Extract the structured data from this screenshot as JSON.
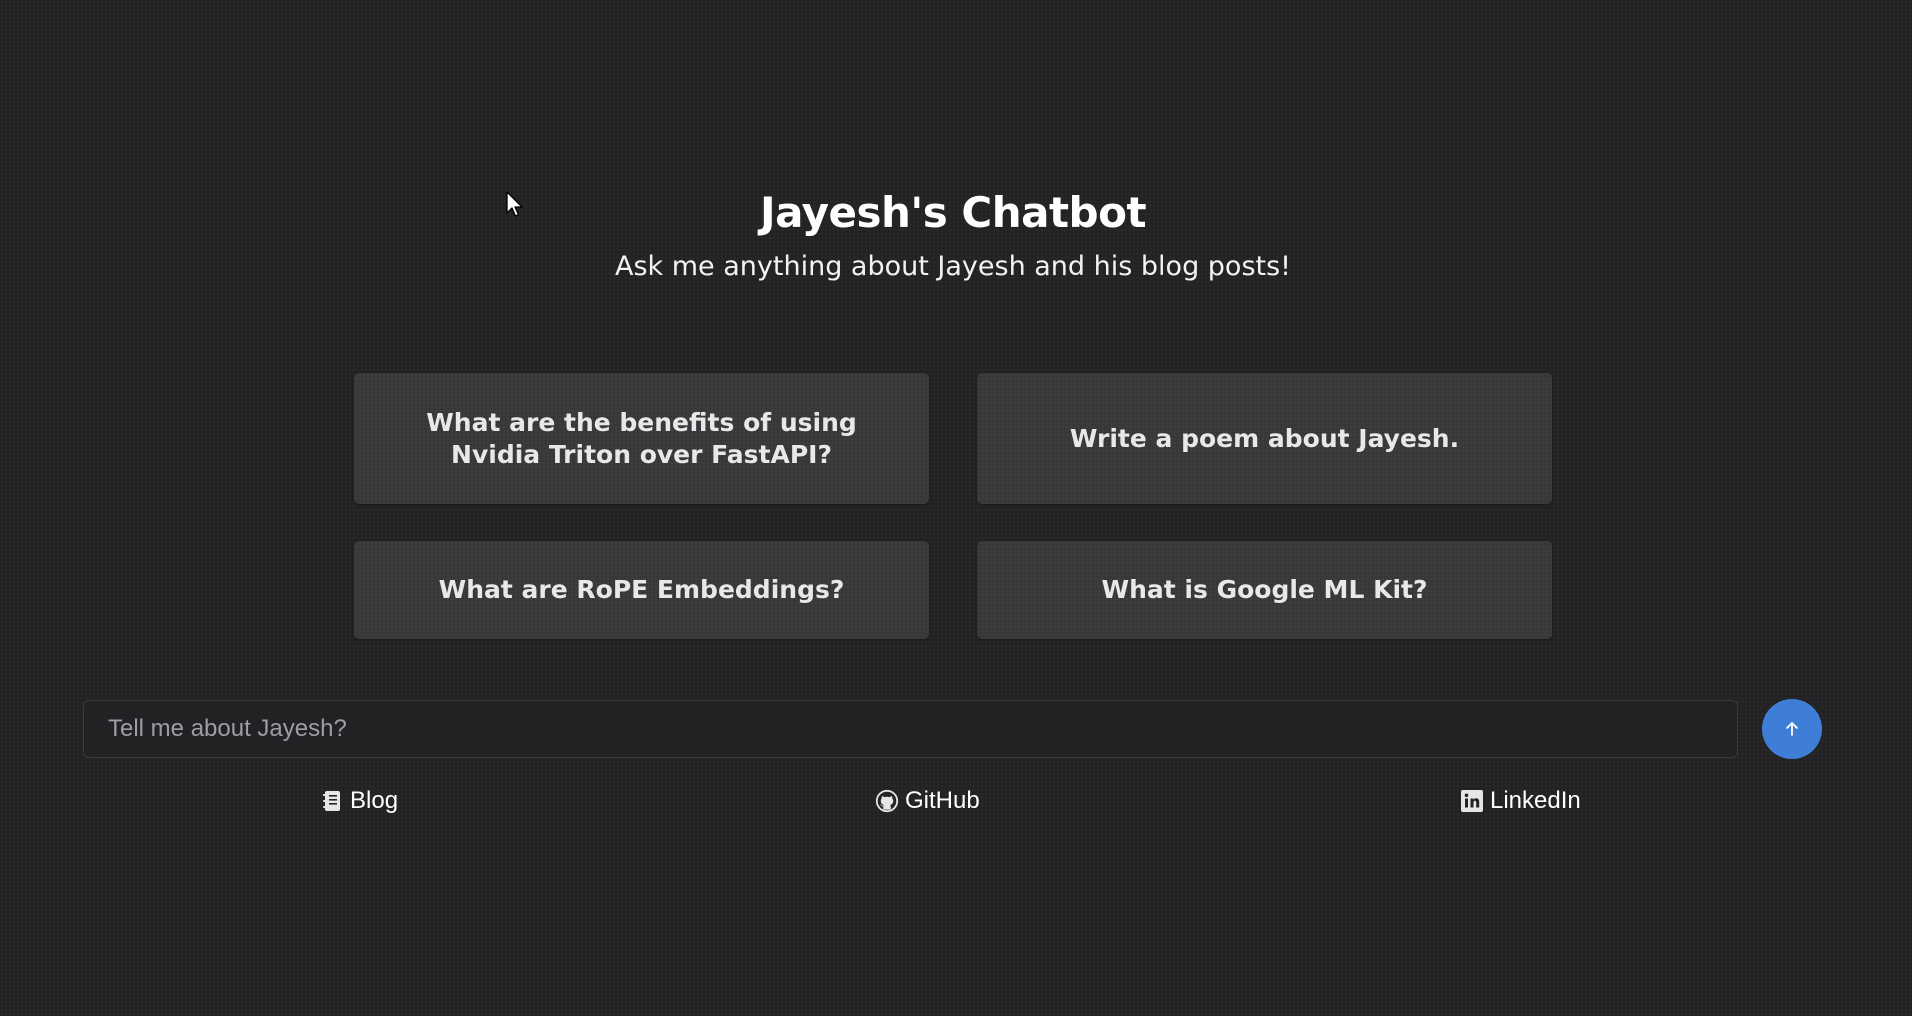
{
  "header": {
    "title": "Jayesh's Chatbot",
    "subtitle": "Ask me anything about Jayesh and his blog posts!"
  },
  "suggestions": [
    {
      "label": "What are the benefits of using Nvidia Triton over FastAPI?"
    },
    {
      "label": "Write a poem about Jayesh."
    },
    {
      "label": "What are RoPE Embeddings?"
    },
    {
      "label": "What is Google ML Kit?"
    }
  ],
  "chat": {
    "placeholder": "Tell me about Jayesh?",
    "value": "",
    "send_icon": "arrow-up-icon"
  },
  "footer": {
    "links": [
      {
        "label": "Blog",
        "icon": "notebook-icon"
      },
      {
        "label": "GitHub",
        "icon": "github-icon"
      },
      {
        "label": "LinkedIn",
        "icon": "linkedin-icon"
      }
    ]
  },
  "colors": {
    "background": "#232325",
    "card": "#38383b",
    "accent": "#3f7ed6"
  }
}
